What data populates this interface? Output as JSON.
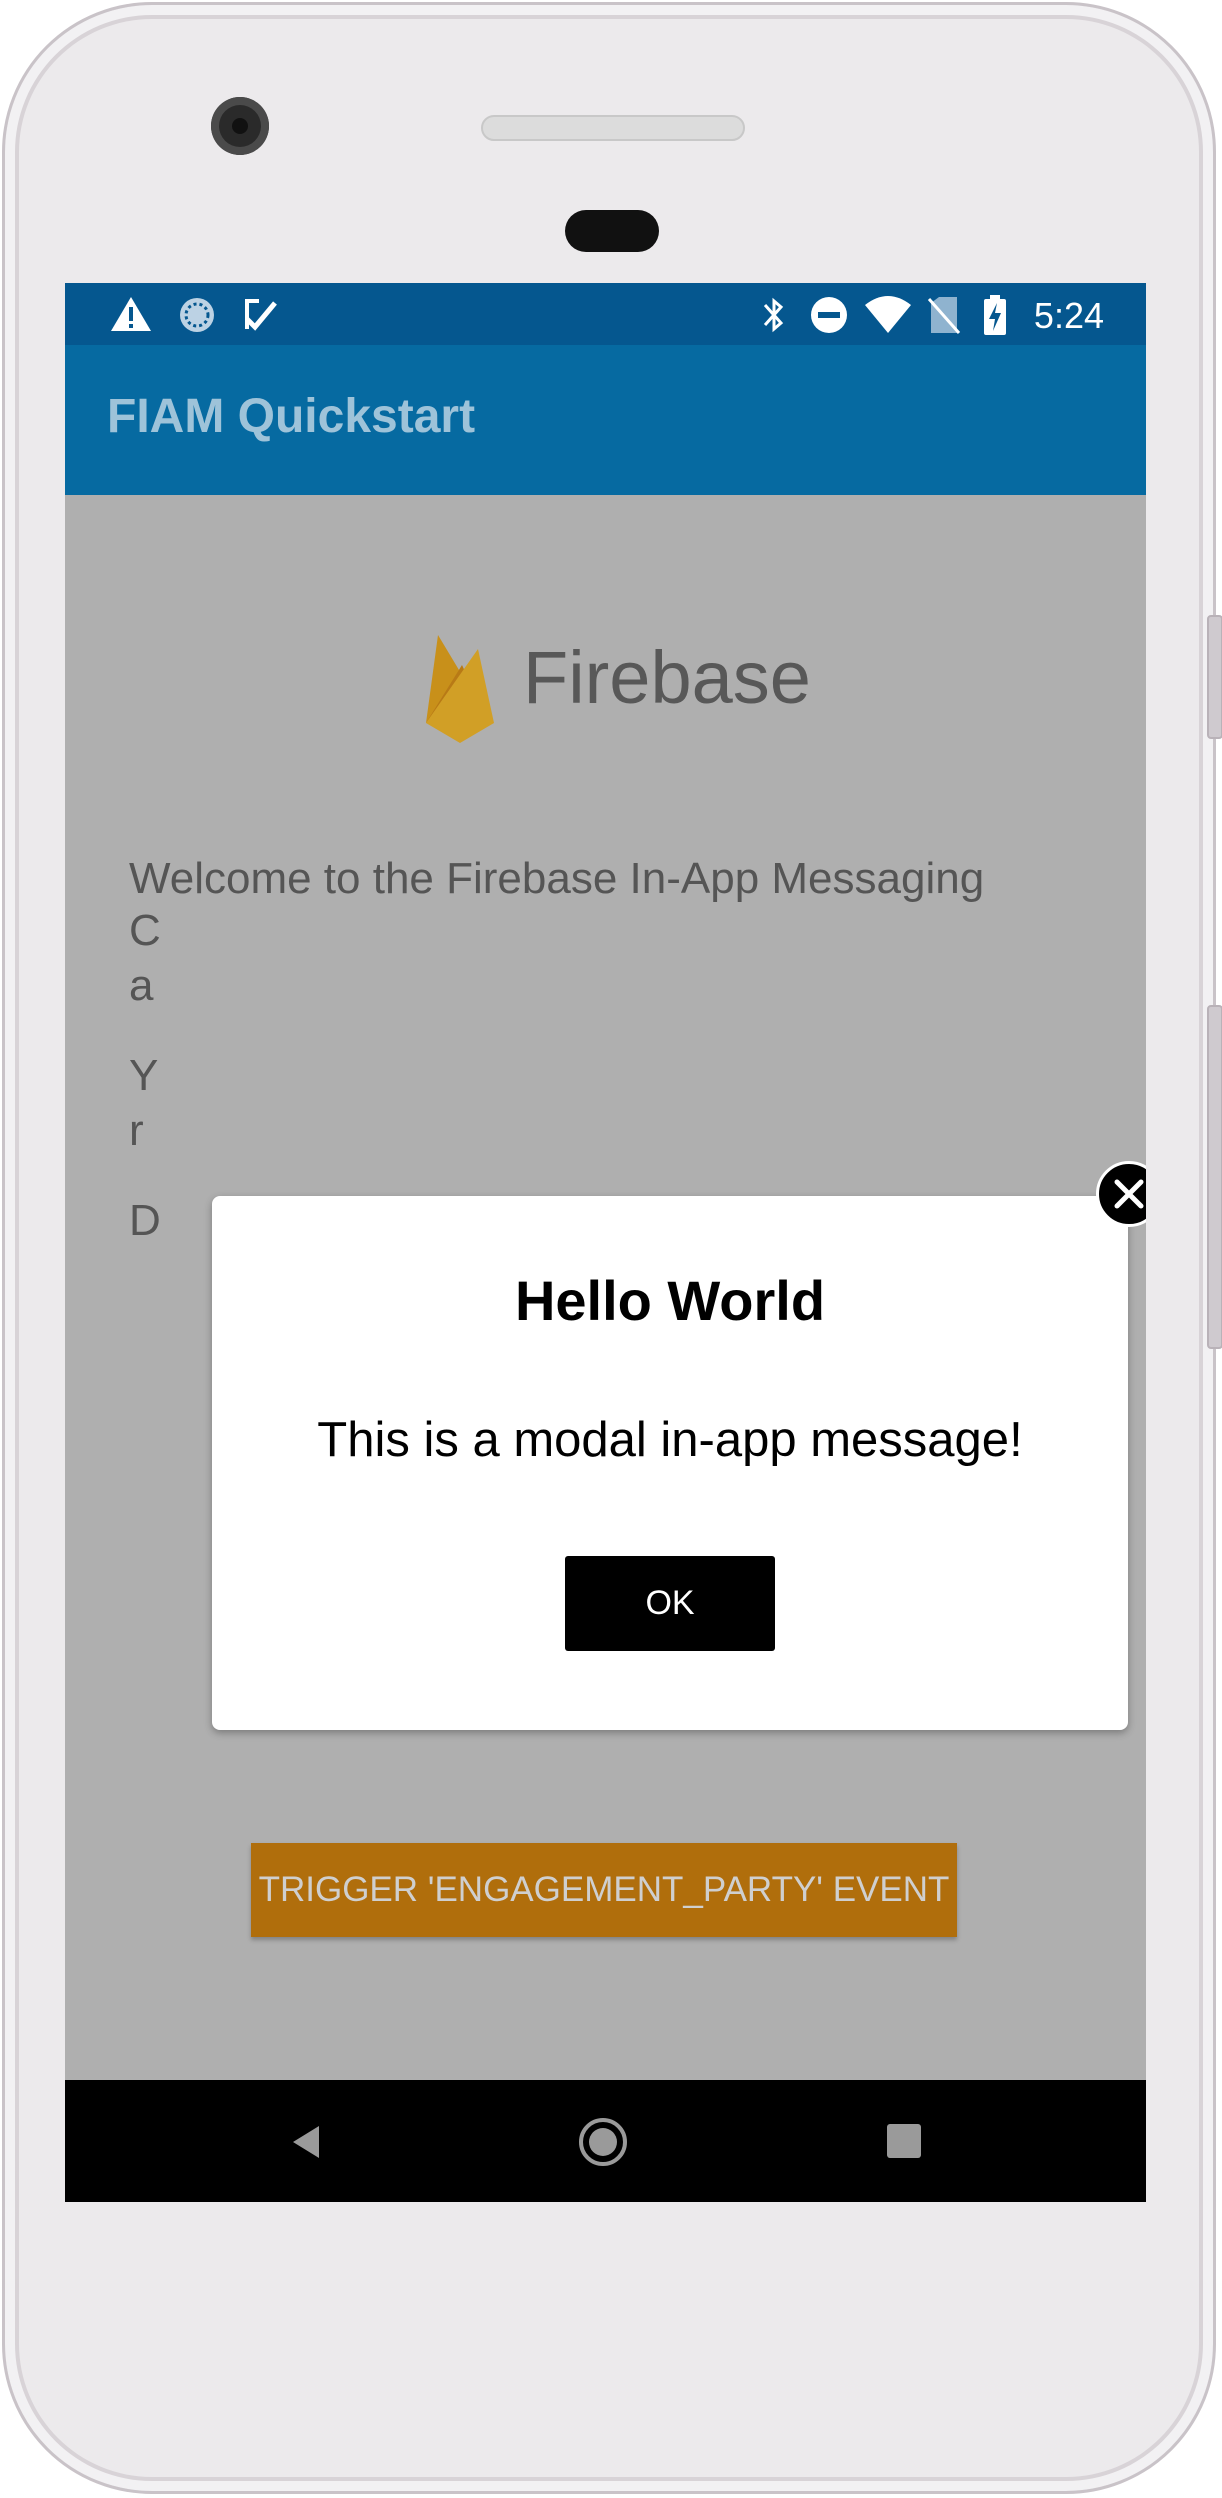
{
  "app": {
    "title": "FIAM Quickstart",
    "accent": "#066aa1",
    "status_bar_color": "#05578f"
  },
  "status_bar": {
    "time": "5:24",
    "left_icons": [
      "warning-icon",
      "loading-icon",
      "check-task-icon"
    ],
    "right_icons": [
      "bluetooth-icon",
      "do-not-disturb-icon",
      "wifi-icon",
      "no-sim-icon",
      "battery-charging-icon"
    ]
  },
  "main": {
    "logo_text": "Firebase",
    "welcome_line": "Welcome to the Firebase In-App Messaging",
    "partial_line_1": "C",
    "partial_line_2": "a",
    "partial_line_3": "Y",
    "partial_line_4": "r",
    "partial_line_5": "D",
    "trigger_button_label": "TRIGGER 'ENGAGEMENT_PARTY' EVENT",
    "trigger_button_color": "#b06e0c"
  },
  "modal": {
    "title": "Hello World",
    "body": "This is a modal in-app message!",
    "button_label": "OK",
    "close_icon": "close-icon"
  },
  "nav_bar": {
    "buttons": [
      "back-icon",
      "home-icon",
      "recents-icon"
    ]
  }
}
